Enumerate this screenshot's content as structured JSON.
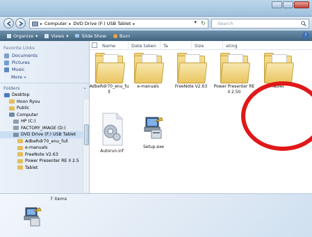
{
  "address": {
    "crumbs": [
      "Computer",
      "DVD Drive (F:) USB Tablet"
    ],
    "search_placeholder": "Search"
  },
  "toolbar": {
    "organize": "Organize",
    "views": "Views",
    "slideshow": "Slide Show",
    "burn": "Burn"
  },
  "nav": {
    "favorites_heading": "Favorite Links",
    "favorites": [
      "Documents",
      "Pictures",
      "Music"
    ],
    "more": "More »",
    "folders_heading": "Folders",
    "tree": [
      "Desktop",
      "Hoon Ryou",
      "Public",
      "Computer",
      "HP (C:)",
      "FACTORY_IMAGE (D:)",
      "DVD Drive (F:) USB Tablet",
      "AdbeRdr70_enu_full",
      "e-manuals",
      "FreeNote V2.63",
      "Power Presenter RE II 2.5",
      "Tablet"
    ]
  },
  "columns": [
    "Name",
    "Date taken",
    "Ta",
    "Size",
    "ating"
  ],
  "files": [
    {
      "label": "AdbeRdr70_enu_fu ll",
      "kind": "folder"
    },
    {
      "label": "e-manuals",
      "kind": "folder"
    },
    {
      "label": "FreeNote V2.63",
      "kind": "folder"
    },
    {
      "label": "Power Presenter RE II 2.50",
      "kind": "folder"
    },
    {
      "label": "Tablet",
      "kind": "folder"
    },
    {
      "label": "Autorun.inf",
      "kind": "inf"
    },
    {
      "label": "Setup.exe",
      "kind": "exe"
    }
  ],
  "status": {
    "count": "7 items"
  },
  "colors": {
    "highlight_ring": "#e01818",
    "toolbar_top": "#6e8fa9"
  }
}
